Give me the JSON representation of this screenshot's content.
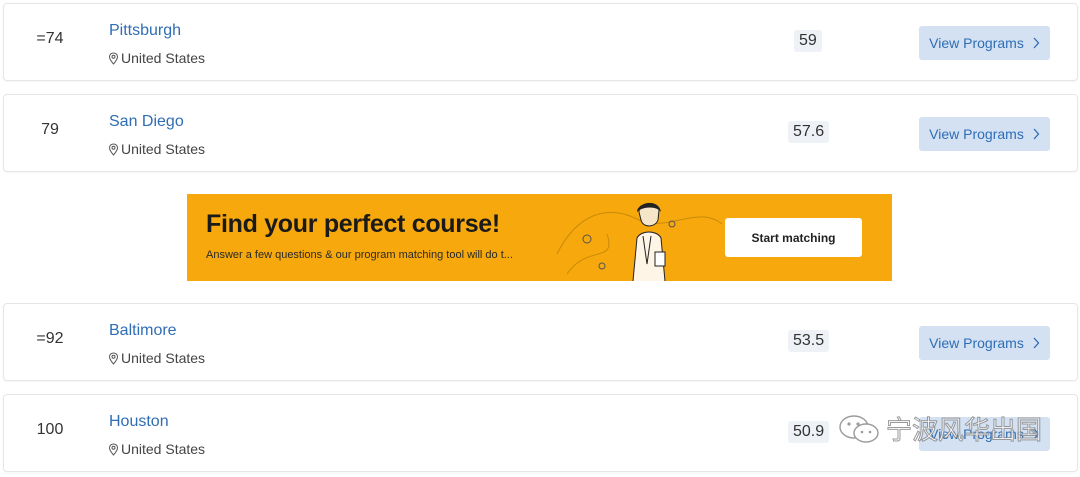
{
  "rankings": [
    {
      "rank": "=74",
      "city": "Pittsburgh",
      "country": "United States",
      "score": "59",
      "button": "View Programs"
    },
    {
      "rank": "79",
      "city": "San Diego",
      "country": "United States",
      "score": "57.6",
      "button": "View Programs"
    },
    {
      "rank": "=92",
      "city": "Baltimore",
      "country": "United States",
      "score": "53.5",
      "button": "View Programs"
    },
    {
      "rank": "100",
      "city": "Houston",
      "country": "United States",
      "score": "50.9",
      "button": "View Programs"
    }
  ],
  "banner": {
    "title": "Find your perfect course!",
    "subtitle": "Answer a few questions & our program matching tool will do t...",
    "button": "Start matching",
    "color": "#f6a80c"
  },
  "watermark": {
    "text": "宁波风华出国"
  },
  "colors": {
    "link": "#2f6db5",
    "button_bg": "#d3e1f2",
    "score_bg": "#eef1f6"
  }
}
